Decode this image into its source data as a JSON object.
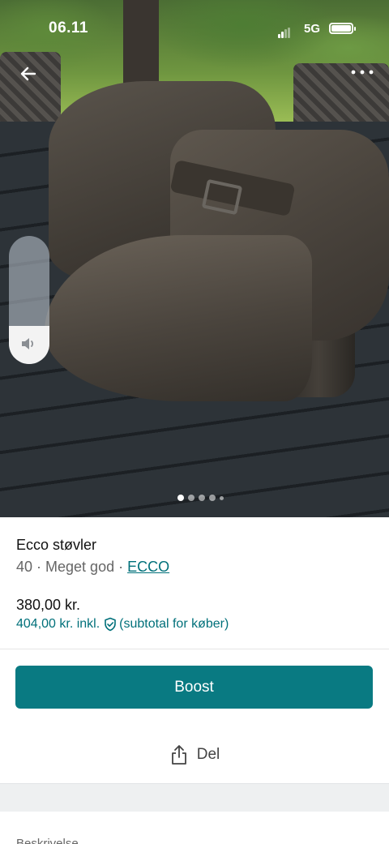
{
  "status_bar": {
    "time": "06.11",
    "network": "5G"
  },
  "gallery": {
    "image_count": 5,
    "active_index": 0,
    "volume_level": 0.3
  },
  "item": {
    "title": "Ecco støvler",
    "size": "40",
    "separator": " · ",
    "condition": "Meget god",
    "brand": "ECCO",
    "price": "380,00 kr.",
    "price_incl": "404,00 kr. inkl.",
    "price_incl_note": "(subtotal for køber)"
  },
  "actions": {
    "boost_label": "Boost",
    "share_label": "Del"
  },
  "description": {
    "label": "Beskrivelse"
  },
  "colors": {
    "accent": "#097a82",
    "link": "#00707a"
  },
  "icons": {
    "back": "arrow-left-icon",
    "more": "more-horizontal-icon",
    "volume": "speaker-icon",
    "shield": "shield-check-icon",
    "share": "share-icon"
  }
}
